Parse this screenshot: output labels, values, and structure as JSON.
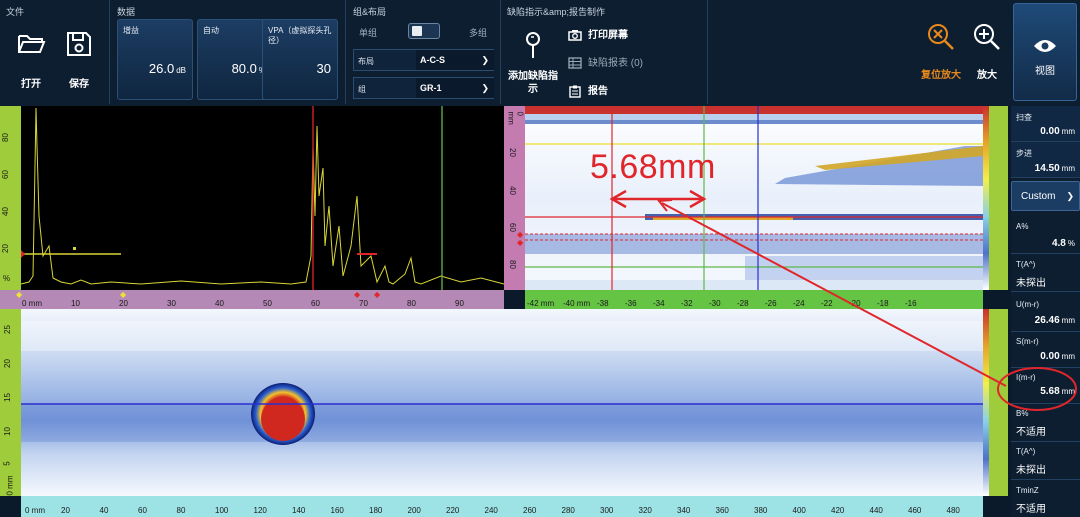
{
  "toolbar": {
    "file_group": "文件",
    "open_label": "打开",
    "save_label": "保存",
    "data_group": "数据",
    "gain": {
      "label": "增益",
      "value": "26.0",
      "unit": "dB"
    },
    "auto": {
      "label": "自动",
      "value": "80.0",
      "unit": "%"
    },
    "vpa": {
      "label": "VPA（虚拟探头孔径）",
      "value": "30"
    },
    "layout_group": "组&布局",
    "single_label": "单组",
    "multi_label": "多组",
    "layout_label": "布局",
    "layout_value": "A-C-S",
    "group_label": "组",
    "group_value": "GR-1",
    "flaw_group": "缺陷指示&amp;报告制作",
    "add_flaw_label": "添加缺陷指示",
    "print_label": "打印屏幕",
    "flaw_table_label": "缺陷报表 (0)",
    "report_label": "报告",
    "reset_zoom_label": "复位放大",
    "zoom_label": "放大",
    "view_label": "视图"
  },
  "right_panel": {
    "scan": {
      "label": "扫查",
      "value": "0.00",
      "unit": "mm"
    },
    "index": {
      "label": "步进",
      "value": "14.50",
      "unit": "mm"
    },
    "custom_label": "Custom",
    "a_pct": {
      "label": "A%",
      "value": "4.8",
      "unit": "%"
    },
    "t_a": {
      "label": "T(A^)",
      "value": "未探出"
    },
    "u_mr": {
      "label": "U(m-r)",
      "value": "26.46",
      "unit": "mm"
    },
    "s_mr": {
      "label": "S(m-r)",
      "value": "0.00",
      "unit": "mm"
    },
    "i_mr": {
      "label": "I(m-r)",
      "value": "5.68",
      "unit": "mm"
    },
    "b_pct": {
      "label": "B%",
      "value": "不适用"
    },
    "t_a2": {
      "label": "T(A^)",
      "value": "未探出"
    },
    "tminz": {
      "label": "TminZ",
      "value": "不适用"
    }
  },
  "annotation": {
    "text": "5.68mm",
    "color": "#e0262b"
  },
  "ascan": {
    "left_axis_unit": "%",
    "left_ticks": [
      "80",
      "60",
      "40",
      "20",
      "0"
    ],
    "bottom_unit": "0 mm",
    "bottom_ticks": [
      "10",
      "20",
      "30",
      "40",
      "50",
      "60",
      "70",
      "80",
      "90"
    ]
  },
  "sscan": {
    "left_unit": "0 mm",
    "left_ticks": [
      "20",
      "40",
      "60",
      "80"
    ],
    "bottom_ticks": [
      "-42 mm",
      "-40 mm",
      "-38",
      "-36",
      "-34",
      "-32",
      "-30",
      "-28",
      "-26",
      "-24",
      "-22",
      "-20",
      "-18",
      "-16"
    ]
  },
  "cscan": {
    "left_unit": "0 mm",
    "left_ticks": [
      "25",
      "20",
      "15",
      "10",
      "5"
    ],
    "bottom_unit": "0 mm",
    "bottom_ticks": [
      "20",
      "40",
      "60",
      "80",
      "100",
      "120",
      "140",
      "160",
      "180",
      "200",
      "220",
      "240",
      "260",
      "280",
      "300",
      "320",
      "340",
      "360",
      "380",
      "400",
      "420",
      "440",
      "460",
      "480"
    ]
  },
  "colors": {
    "accent_orange": "#e8891c",
    "cursor_red": "#e0262b",
    "ascan_trace": "#d9d637",
    "gate_green": "#5fb84a",
    "cursor_blue": "#2a2fd0"
  }
}
